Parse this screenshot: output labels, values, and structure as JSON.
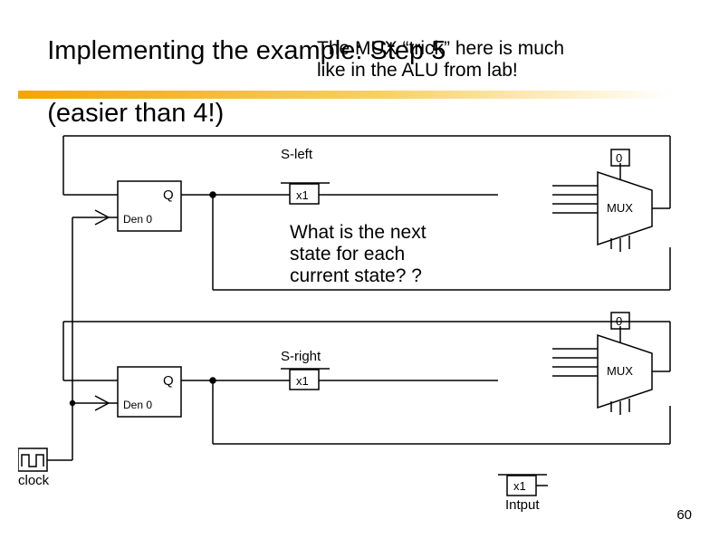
{
  "title_line1": "Implementing the example: Step 5",
  "title_line2": "(easier than 4!)",
  "subtitle_line1": "The MUX “trick” here is much",
  "subtitle_line2": "like in the ALU from lab!",
  "central_q_line1": "What is the next",
  "central_q_line2": "state for each",
  "central_q_line3": "current state? ?",
  "page_number": "60",
  "labels": {
    "s_left": "S-left",
    "s_right": "S-right",
    "q": "Q",
    "den0": "Den 0",
    "x1": "x1",
    "zero": "0",
    "mux": "MUX",
    "input": "Intput",
    "clock": "clock"
  }
}
